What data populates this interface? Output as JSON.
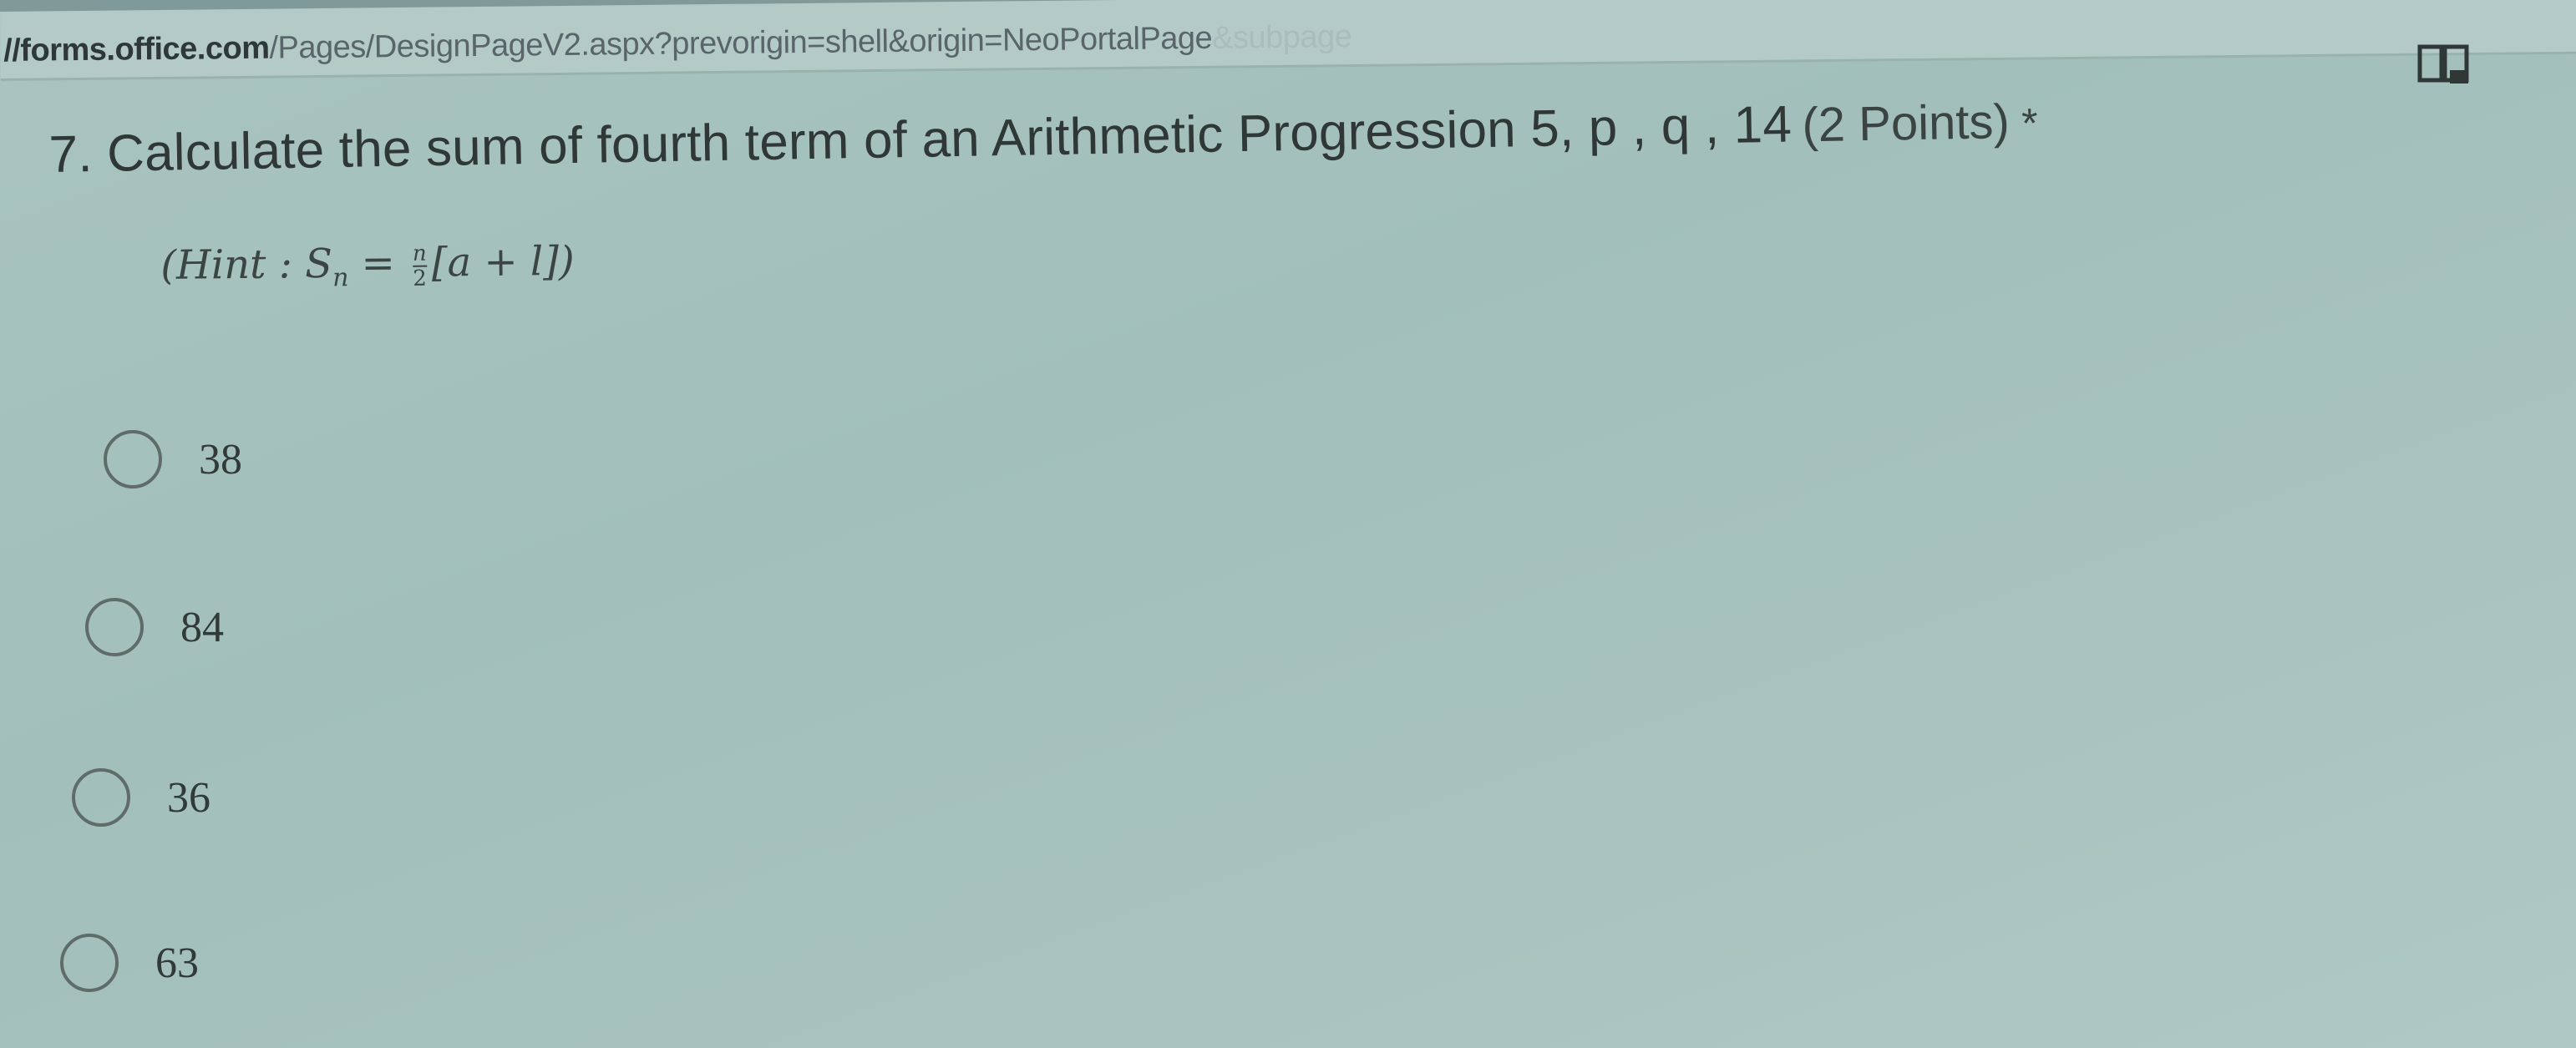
{
  "browser": {
    "url_host": "//forms.office.com",
    "url_path": "/Pages/DesignPageV2.aspx?prevorigin=shell&origin=NeoPortalPage",
    "url_fade": "&subpage"
  },
  "question": {
    "title": "7. Calculate the sum of fourth term of an Arithmetic Progression 5, p , q , 14",
    "points": "(2 Points)",
    "required_marker": "*",
    "hint_prefix": "(Hint  :  S",
    "hint_sub": "n",
    "hint_eq": " = ",
    "hint_num": "n",
    "hint_den": "2",
    "hint_suffix": "[a + l])"
  },
  "options": [
    {
      "label": "38"
    },
    {
      "label": "84"
    },
    {
      "label": "36"
    },
    {
      "label": "63"
    }
  ],
  "icons": {
    "immersive_reader": "immersive-reader-icon"
  }
}
